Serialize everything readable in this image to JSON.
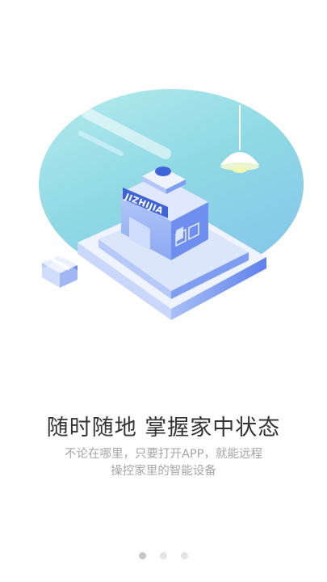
{
  "onboarding": {
    "building_sign": "JIZHIJIA",
    "headline": "随时随地 掌握家中状态",
    "subtext_line1": "不论在哪里，只要打开APP，就能远程",
    "subtext_line2": "操控家里的智能设备",
    "page_indicator": {
      "total": 3,
      "current": 1
    }
  },
  "colors": {
    "circle_top": "#a8e6ea",
    "circle_bottom": "#8fd6e4",
    "platform_top": "#dfe9fb",
    "platform_side": "#6d8ff0",
    "building_wall": "#9bb6f4",
    "building_dark": "#4c6fe0",
    "sign_bg": "#3f63d8",
    "lamp_light": "#f3f7b4",
    "text_dark": "#333333",
    "text_gray": "#a6a6a6"
  }
}
